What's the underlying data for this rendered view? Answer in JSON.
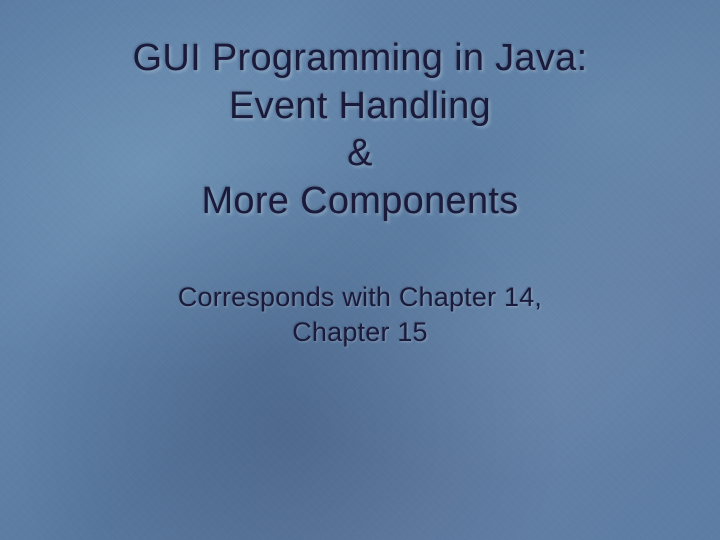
{
  "slide": {
    "title": {
      "line1": "GUI Programming in Java:",
      "line2": "Event Handling",
      "line3": "&",
      "line4": "More Components"
    },
    "subtitle": {
      "line1": "Corresponds with Chapter 14,",
      "line2": "Chapter 15"
    }
  }
}
